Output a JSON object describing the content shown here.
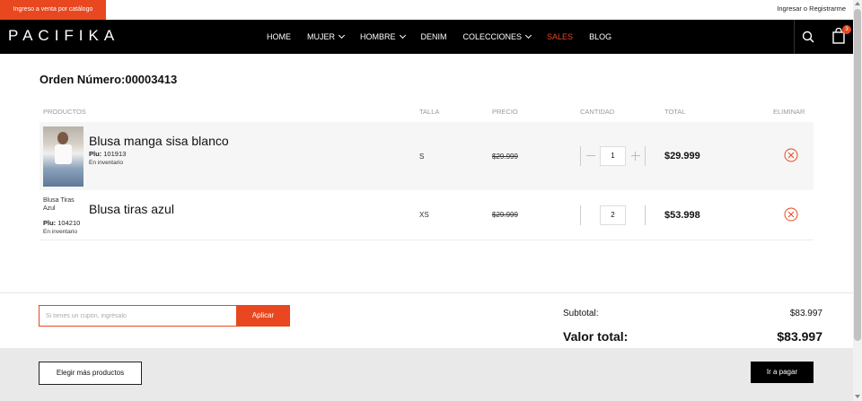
{
  "topbar": {
    "catalog_label": "Ingreso a venta por catálogo",
    "login_label": "Ingresar o Registrarme"
  },
  "header": {
    "logo": "PACIFIKA",
    "nav": [
      {
        "label": "HOME",
        "dropdown": false
      },
      {
        "label": "MUJER",
        "dropdown": true
      },
      {
        "label": "HOMBRE",
        "dropdown": true
      },
      {
        "label": "DENIM",
        "dropdown": false
      },
      {
        "label": "COLECCIONES",
        "dropdown": true
      },
      {
        "label": "SALES",
        "dropdown": false
      },
      {
        "label": "BLOG",
        "dropdown": false
      }
    ],
    "cart_count": "3"
  },
  "order": {
    "title": "Orden Número:00003413",
    "columns": {
      "products": "PRODUCTOS",
      "size": "TALLA",
      "price": "PRECIO",
      "quantity": "CANTIDAD",
      "total": "TOTAL",
      "remove": "ELIMINAR"
    },
    "items": [
      {
        "name": "Blusa manga sisa blanco",
        "plu_label": "Plu:",
        "plu": "101913",
        "stock": "En inventario",
        "size": "S",
        "price": "$29.999",
        "quantity": "1",
        "total": "$29.999",
        "image_alt": ""
      },
      {
        "name": "Blusa tiras azul",
        "plu_label": "Plu:",
        "plu": "104210",
        "stock": "En inventario",
        "size": "XS",
        "price": "$29.999",
        "quantity": "2",
        "total": "$53.998",
        "image_alt": "Blusa Tiras Azul"
      }
    ]
  },
  "coupon": {
    "placeholder": "Si tienes un cupón, ingrésalo",
    "apply_label": "Aplicar"
  },
  "summary": {
    "subtotal_label": "Subtotal:",
    "subtotal": "$83.997",
    "total_label": "Valor total:",
    "total": "$83.997"
  },
  "footer": {
    "more_label": "Elegir más productos",
    "pay_label": "Ir a pagar"
  },
  "colors": {
    "accent": "#e8471f",
    "header_bg": "#000000",
    "footer_bg": "#e9e9e9"
  }
}
